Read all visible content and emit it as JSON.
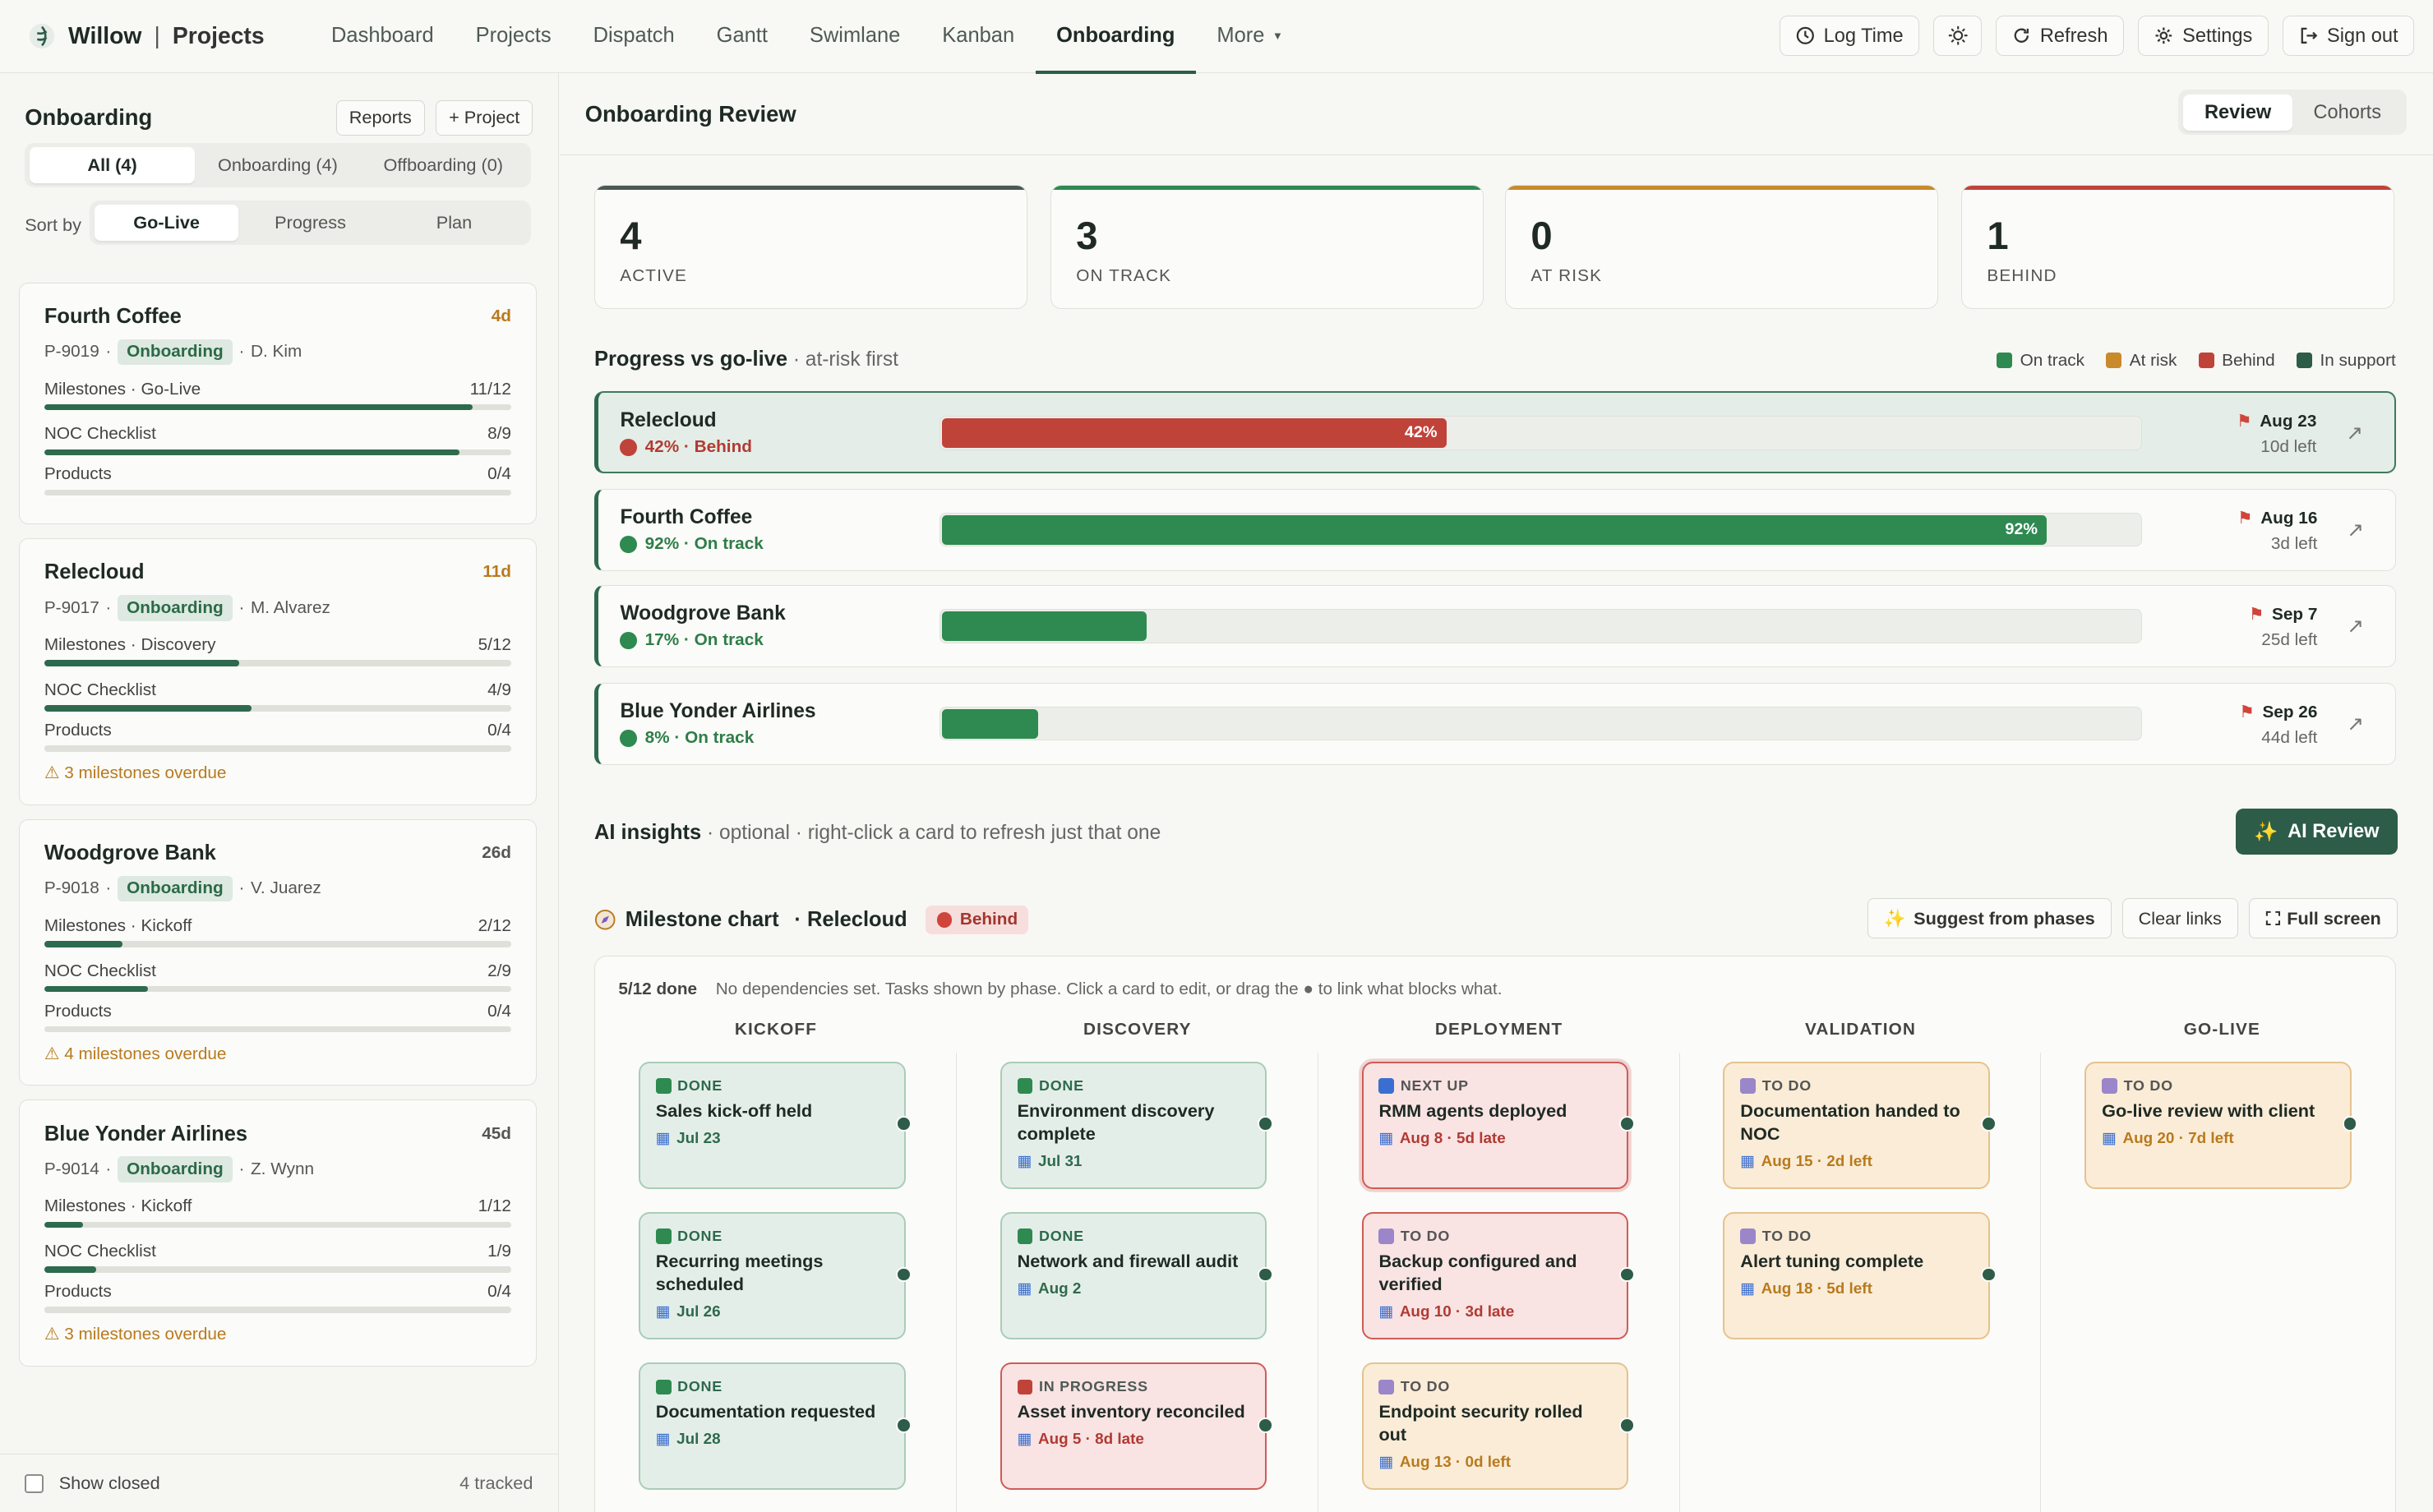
{
  "app": {
    "name": "Willow",
    "separator": "|",
    "section": "Projects"
  },
  "nav": [
    "Dashboard",
    "Projects",
    "Dispatch",
    "Gantt",
    "Swimlane",
    "Kanban",
    "Onboarding",
    "More"
  ],
  "topbar": {
    "log_time": "Log Time",
    "refresh": "Refresh",
    "settings": "Settings",
    "sign_out": "Sign out"
  },
  "sidebar": {
    "title": "Onboarding",
    "reports": "Reports",
    "add_project": "+ Project",
    "filters": [
      "All (4)",
      "Onboarding (4)",
      "Offboarding (0)"
    ],
    "sort_label": "Sort by",
    "sorts": [
      "Go-Live",
      "Progress",
      "Plan"
    ],
    "projects": [
      {
        "name": "Fourth Coffee",
        "days": "4d",
        "id": "P-9019",
        "tag": "Onboarding",
        "owner": "D. Kim",
        "milestones_label": "Milestones · Go-Live",
        "milestones": "11/12",
        "milestones_pct": 0.917,
        "noc_label": "NOC Checklist",
        "noc": "8/9",
        "noc_pct": 0.889,
        "products_label": "Products",
        "products": "0/4",
        "products_pct": 0,
        "overdue": ""
      },
      {
        "name": "Relecloud",
        "days": "11d",
        "id": "P-9017",
        "tag": "Onboarding",
        "owner": "M. Alvarez",
        "milestones_label": "Milestones · Discovery",
        "milestones": "5/12",
        "milestones_pct": 0.417,
        "noc_label": "NOC Checklist",
        "noc": "4/9",
        "noc_pct": 0.444,
        "products_label": "Products",
        "products": "0/4",
        "products_pct": 0,
        "overdue": "⚠ 3 milestones overdue"
      },
      {
        "name": "Woodgrove Bank",
        "days": "26d",
        "id": "P-9018",
        "tag": "Onboarding",
        "owner": "V. Juarez",
        "milestones_label": "Milestones · Kickoff",
        "milestones": "2/12",
        "milestones_pct": 0.167,
        "noc_label": "NOC Checklist",
        "noc": "2/9",
        "noc_pct": 0.222,
        "products_label": "Products",
        "products": "0/4",
        "products_pct": 0,
        "overdue": "⚠ 4 milestones overdue"
      },
      {
        "name": "Blue Yonder Airlines",
        "days": "45d",
        "id": "P-9014",
        "tag": "Onboarding",
        "owner": "Z. Wynn",
        "milestones_label": "Milestones · Kickoff",
        "milestones": "1/12",
        "milestones_pct": 0.083,
        "noc_label": "NOC Checklist",
        "noc": "1/9",
        "noc_pct": 0.111,
        "products_label": "Products",
        "products": "0/4",
        "products_pct": 0,
        "overdue": "⚠ 3 milestones overdue"
      }
    ],
    "show_closed": "Show closed",
    "tracked": "4 tracked"
  },
  "main": {
    "title": "Onboarding Review",
    "tabs": [
      "Review",
      "Cohorts"
    ],
    "stats": [
      {
        "num": "4",
        "label": "ACTIVE",
        "color": "#4b5a52"
      },
      {
        "num": "3",
        "label": "ON TRACK",
        "color": "#2e8a50"
      },
      {
        "num": "0",
        "label": "AT RISK",
        "color": "#c98a2b"
      },
      {
        "num": "1",
        "label": "BEHIND",
        "color": "#c0433a"
      }
    ],
    "progress_title": "Progress vs go-live",
    "progress_sub": " · at-risk first",
    "legend": [
      {
        "label": "On track",
        "color": "#2e8a50"
      },
      {
        "label": "At risk",
        "color": "#c98a2b"
      },
      {
        "label": "Behind",
        "color": "#c0433a"
      },
      {
        "label": "In support",
        "color": "#2d5c48"
      }
    ],
    "rows": [
      {
        "name": "Relecloud",
        "status": "42% · Behind",
        "pct": 0.42,
        "bar_label": "42%",
        "color": "#c0433a",
        "date": "Aug 23",
        "left": "10d left"
      },
      {
        "name": "Fourth Coffee",
        "status": "92% · On track",
        "pct": 0.92,
        "bar_label": "92%",
        "color": "#2e8a50",
        "date": "Aug 16",
        "left": "3d left"
      },
      {
        "name": "Woodgrove Bank",
        "status": "17% · On track",
        "pct": 0.17,
        "bar_label": "",
        "color": "#2e8a50",
        "date": "Sep 7",
        "left": "25d left"
      },
      {
        "name": "Blue Yonder Airlines",
        "status": "8% · On track",
        "pct": 0.08,
        "bar_label": "",
        "color": "#2e8a50",
        "date": "Sep 26",
        "left": "44d left"
      }
    ],
    "ai_title": "AI insights",
    "ai_sub": " · optional · right-click a card to refresh just that one",
    "ai_button": "AI Review",
    "milestone": {
      "title": "Milestone chart",
      "project": "· Relecloud",
      "status": "Behind",
      "suggest": "Suggest from phases",
      "clear": "Clear links",
      "fullscreen": "Full screen",
      "done": "5/12 done",
      "info": "No dependencies set. Tasks shown by phase. Click a card to edit, or drag the ● to link what blocks what.",
      "columns": [
        {
          "name": "KICKOFF",
          "cards": [
            {
              "k": "DONE",
              "t": "Sales kick-off held",
              "d": "Jul 23",
              "s": "done"
            },
            {
              "k": "DONE",
              "t": "Recurring meetings scheduled",
              "d": "Jul 26",
              "s": "done"
            },
            {
              "k": "DONE",
              "t": "Documentation requested",
              "d": "Jul 28",
              "s": "done"
            }
          ]
        },
        {
          "name": "DISCOVERY",
          "cards": [
            {
              "k": "DONE",
              "t": "Environment discovery complete",
              "d": "Jul 31",
              "s": "done"
            },
            {
              "k": "DONE",
              "t": "Network and firewall audit",
              "d": "Aug 2",
              "s": "done"
            },
            {
              "k": "IN PROGRESS",
              "t": "Asset inventory reconciled",
              "d": "Aug 5 · 8d late",
              "s": "late"
            }
          ]
        },
        {
          "name": "DEPLOYMENT",
          "cards": [
            {
              "k": "NEXT UP",
              "t": "RMM agents deployed",
              "d": "Aug 8 · 5d late",
              "s": "next"
            },
            {
              "k": "TO DO",
              "t": "Backup configured and verified",
              "d": "Aug 10 · 3d late",
              "s": "late"
            },
            {
              "k": "TO DO",
              "t": "Endpoint security rolled out",
              "d": "Aug 13 · 0d left",
              "s": "todo"
            }
          ]
        },
        {
          "name": "VALIDATION",
          "cards": [
            {
              "k": "TO DO",
              "t": "Documentation handed to NOC",
              "d": "Aug 15 · 2d left",
              "s": "todo"
            },
            {
              "k": "TO DO",
              "t": "Alert tuning complete",
              "d": "Aug 18 · 5d left",
              "s": "todo"
            }
          ]
        },
        {
          "name": "GO-LIVE",
          "cards": [
            {
              "k": "TO DO",
              "t": "Go-live review with client",
              "d": "Aug 20 · 7d left",
              "s": "todo"
            }
          ]
        }
      ]
    }
  }
}
